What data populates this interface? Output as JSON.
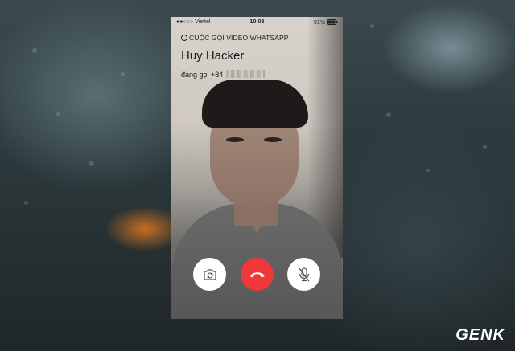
{
  "status_bar": {
    "carrier": "●●○○○ Viettel",
    "time": "10:08",
    "battery": "91%"
  },
  "call": {
    "header": "CUỘC GỌI VIDEO WHATSAPP",
    "contact_name": "Huy Hacker",
    "status_text": "đang gọi +84"
  },
  "controls": {
    "flip_camera_icon": "camera-flip-icon",
    "end_call_icon": "phone-hangup-icon",
    "mute_icon": "microphone-muted-icon"
  },
  "colors": {
    "end_call": "#f0373a",
    "control_bg": "#ffffff"
  },
  "watermark": "GENK"
}
